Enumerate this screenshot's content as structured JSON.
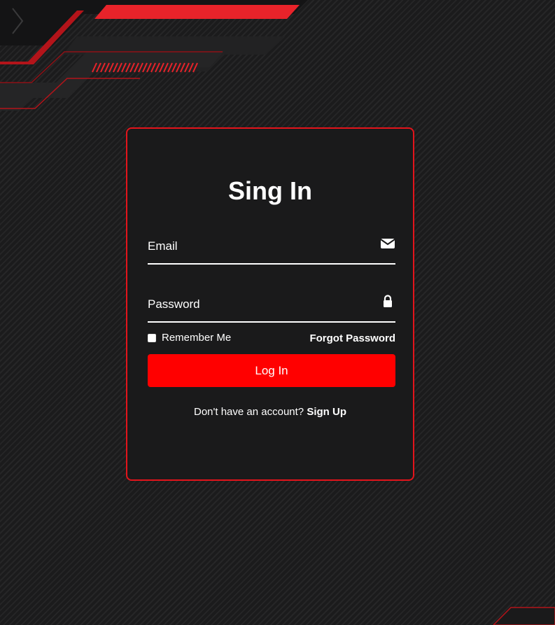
{
  "colors": {
    "accent": "#ff0000",
    "card_border": "#e3141b",
    "card_background": "#1a1a1b",
    "text": "#ffffff"
  },
  "card": {
    "title": "Sing In"
  },
  "form": {
    "email": {
      "placeholder": "Email",
      "value": "",
      "icon": "envelope-icon"
    },
    "password": {
      "placeholder": "Password",
      "value": "",
      "icon": "lock-icon"
    },
    "remember_me": {
      "label": "Remember Me",
      "checked": false
    },
    "forgot_password": "Forgot Password",
    "login_button": "Log In"
  },
  "footer": {
    "prompt": "Don't have an account?",
    "signup_link": "Sign Up"
  }
}
